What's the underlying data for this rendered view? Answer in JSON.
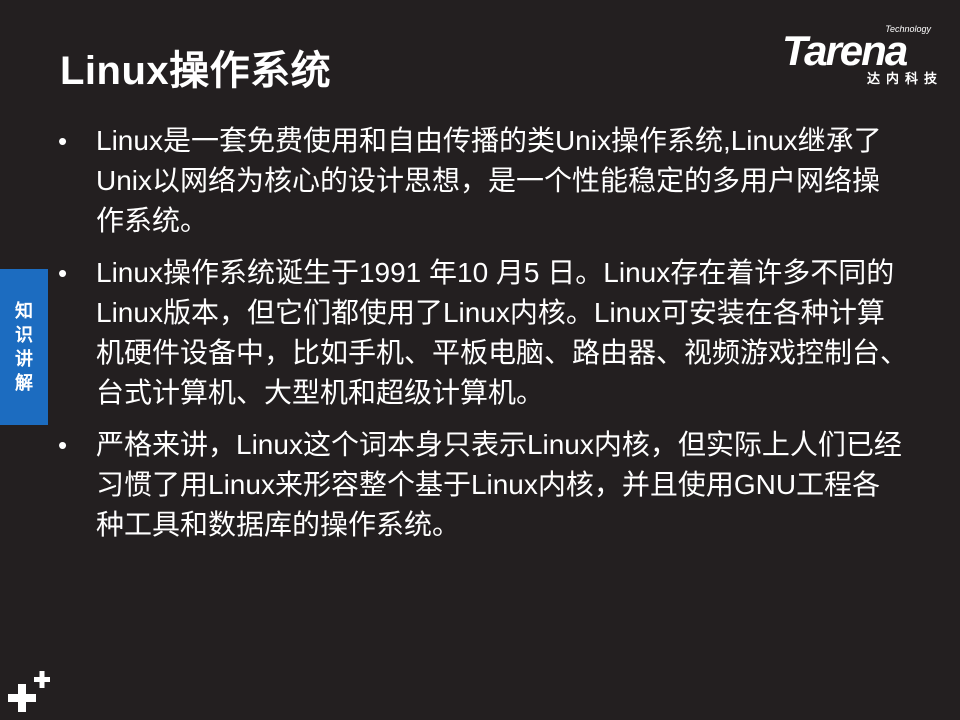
{
  "slide": {
    "title": "Linux操作系统"
  },
  "logo": {
    "technology": "Technology",
    "wordmark": "Tarena",
    "chinese": "达内科技"
  },
  "side_tab": {
    "chars": [
      "知",
      "识",
      "讲",
      "解"
    ]
  },
  "bullets": [
    {
      "marker": "•",
      "text": "Linux是一套免费使用和自由传播的类Unix操作系统,Linux继承了Unix以网络为核心的设计思想，是一个性能稳定的多用户网络操作系统。"
    },
    {
      "marker": "•",
      "text": "Linux操作系统诞生于1991 年10 月5 日。Linux存在着许多不同的Linux版本，但它们都使用了Linux内核。Linux可安装在各种计算机硬件设备中，比如手机、平板电脑、路由器、视频游戏控制台、台式计算机、大型机和超级计算机。"
    },
    {
      "marker": "•",
      "text": "严格来讲，Linux这个词本身只表示Linux内核，但实际上人们已经习惯了用Linux来形容整个基于Linux内核，并且使用GNU工程各种工具和数据库的操作系统。"
    }
  ],
  "colors": {
    "background": "#231f20",
    "accent_blue": "#1c6cc0",
    "text": "#ffffff"
  },
  "icons": {
    "corner": "plus-icon"
  }
}
